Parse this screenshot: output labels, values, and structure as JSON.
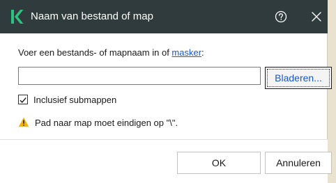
{
  "window": {
    "title": "Naam van bestand of map",
    "logo_letter": "K",
    "help_icon": "help-icon",
    "close_icon": "close-icon"
  },
  "form": {
    "prompt_prefix": "Voer een bestands- of mapnaam in of ",
    "mask_link": "masker",
    "prompt_suffix": ":",
    "name_value": "",
    "browse_label": "Bladeren..."
  },
  "options": {
    "include_subfolders_label": "Inclusief submappen",
    "include_subfolders_checked": true
  },
  "warning": {
    "icon": "warning-icon",
    "text": "Pad naar map moet eindigen op \"\\\"."
  },
  "footer": {
    "ok_label": "OK",
    "cancel_label": "Annuleren"
  },
  "colors": {
    "titlebar": "#2f3b3c",
    "brand": "#2ec27e",
    "link": "#1a56c8",
    "warning": "#f2b705"
  }
}
